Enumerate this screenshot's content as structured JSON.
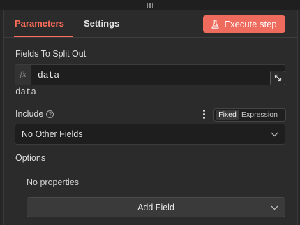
{
  "tabs": [
    {
      "label": "Parameters",
      "active": true
    },
    {
      "label": "Settings",
      "active": false
    }
  ],
  "execute_button": {
    "label": "Execute step",
    "icon": "flask-icon"
  },
  "fields_to_split": {
    "label": "Fields To Split Out",
    "value": "data",
    "preview": "data",
    "fx_label": "fx"
  },
  "include": {
    "label": "Include",
    "info_icon": "?",
    "mode_options": [
      "Fixed",
      "Expression"
    ],
    "mode_selected": "Fixed",
    "selected": "No Other Fields"
  },
  "options": {
    "label": "Options",
    "empty_text": "No properties",
    "add_field_label": "Add Field"
  },
  "colors": {
    "accent": "#ff6d5a",
    "execute_bg": "#ee6b5d",
    "panel_bg": "#2b2b2b",
    "input_bg": "#1e1e1e"
  }
}
